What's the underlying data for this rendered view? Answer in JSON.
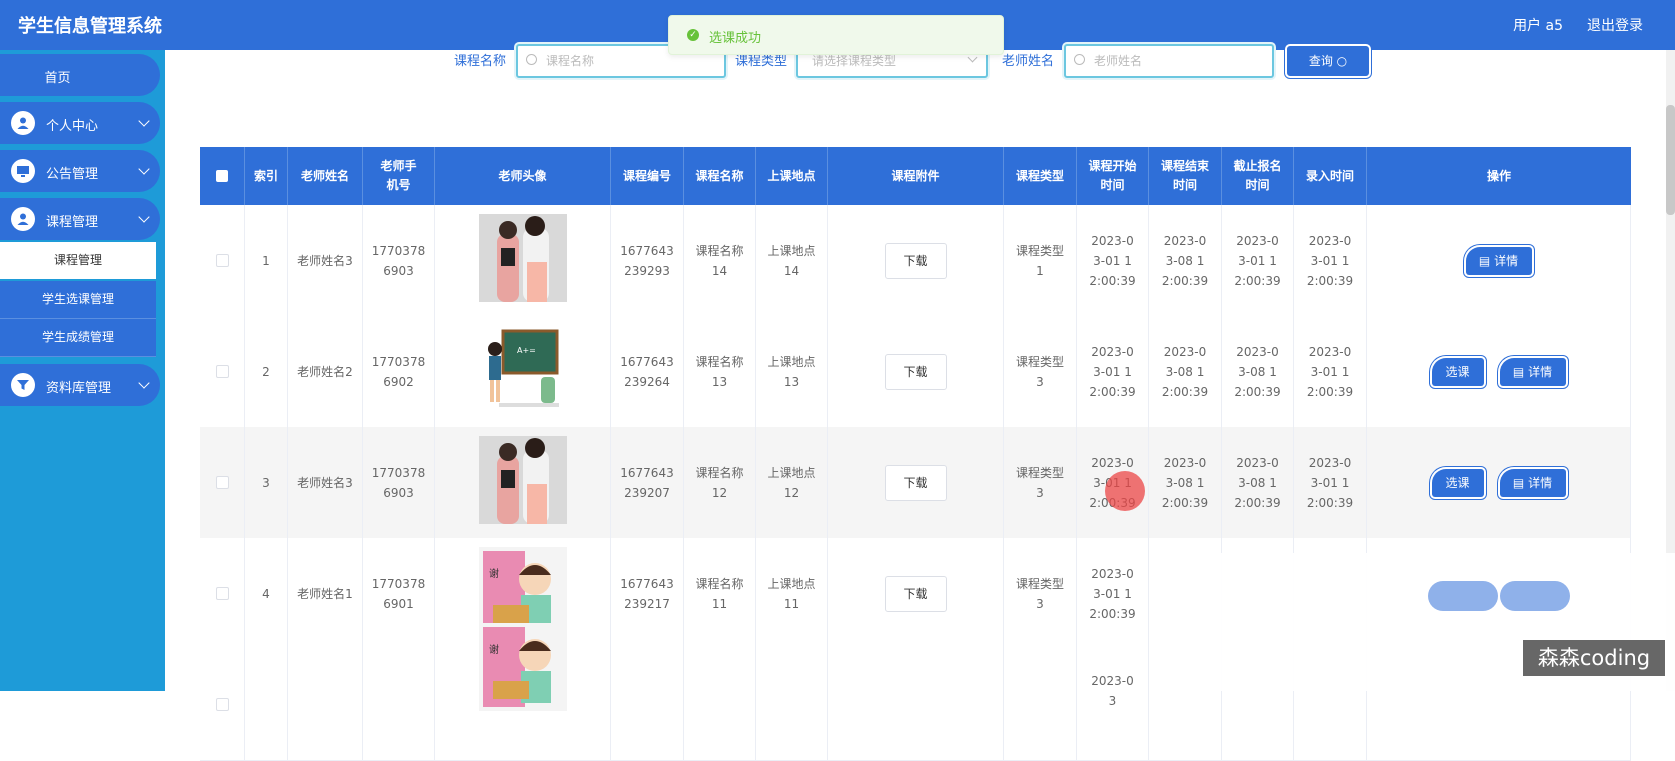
{
  "app": {
    "title": "学生信息管理系统",
    "user": "用户 a5",
    "logout": "退出登录"
  },
  "toast": {
    "text": "选课成功"
  },
  "sidebar": {
    "home": "首页",
    "items": [
      {
        "label": "个人中心",
        "icon": "user-icon"
      },
      {
        "label": "公告管理",
        "icon": "monitor-icon"
      },
      {
        "label": "课程管理",
        "icon": "user-icon"
      }
    ],
    "sub_items": [
      "课程管理",
      "学生选课管理",
      "学生成绩管理"
    ],
    "last": {
      "label": "资料库管理",
      "icon": "funnel-icon"
    }
  },
  "search": {
    "course_name_label": "课程名称",
    "course_name_placeholder": "课程名称",
    "course_type_label": "课程类型",
    "course_type_placeholder": "请选择课程类型",
    "teacher_label": "老师姓名",
    "teacher_placeholder": "老师姓名",
    "query_button": "查询"
  },
  "table": {
    "headers": [
      "索引",
      "老师姓名",
      "老师手机号",
      "老师头像",
      "课程编号",
      "课程名称",
      "上课地点",
      "课程附件",
      "课程类型",
      "课程开始时间",
      "课程结束时间",
      "截止报名时间",
      "录入时间",
      "操作"
    ],
    "download_label": "下载",
    "select_label": "选课",
    "detail_label": "详情",
    "rows": [
      {
        "index": "1",
        "teacher": "老师姓名3",
        "phone": "17703786903",
        "avatar": "photo-teacher-tablet",
        "course_no": "1677643239293",
        "course_name": "课程名称14",
        "location": "上课地点14",
        "type": "课程类型1",
        "start": "2023-03-01 12:00:39",
        "end": "2023-03-08 12:00:39",
        "deadline": "2023-03-01 12:00:39",
        "created": "2023-03-01 12:00:39",
        "can_select": false
      },
      {
        "index": "2",
        "teacher": "老师姓名2",
        "phone": "17703786902",
        "avatar": "cartoon-teacher-blackboard",
        "course_no": "1677643239264",
        "course_name": "课程名称13",
        "location": "上课地点13",
        "type": "课程类型3",
        "start": "2023-03-01 12:00:39",
        "end": "2023-03-08 12:00:39",
        "deadline": "2023-03-08 12:00:39",
        "created": "2023-03-01 12:00:39",
        "can_select": true
      },
      {
        "index": "3",
        "teacher": "老师姓名3",
        "phone": "17703786903",
        "avatar": "photo-teacher-tablet",
        "course_no": "1677643239207",
        "course_name": "课程名称12",
        "location": "上课地点12",
        "type": "课程类型3",
        "start": "2023-03-01 12:00:39",
        "end": "2023-03-08 12:00:39",
        "deadline": "2023-03-08 12:00:39",
        "created": "2023-03-01 12:00:39",
        "can_select": true
      },
      {
        "index": "4",
        "teacher": "老师姓名1",
        "phone": "17703786901",
        "avatar": "cartoon-teacher-pink",
        "course_no": "1677643239217",
        "course_name": "课程名称11",
        "location": "上课地点11",
        "type": "课程类型3",
        "start": "2023-03-01 12:00:39",
        "end": "",
        "deadline": "",
        "created": "",
        "can_select": true
      },
      {
        "index": "",
        "teacher": "",
        "phone": "",
        "avatar": "cartoon-teacher-pink",
        "course_no": "",
        "course_name": "",
        "location": "",
        "type": "",
        "start": "2023-03",
        "end": "",
        "deadline": "",
        "created": "",
        "can_select": true
      }
    ]
  },
  "watermark": "森森coding",
  "colors": {
    "primary": "#2f6fd8",
    "sidebar": "#1e9bd8",
    "success": "#67c23a"
  }
}
